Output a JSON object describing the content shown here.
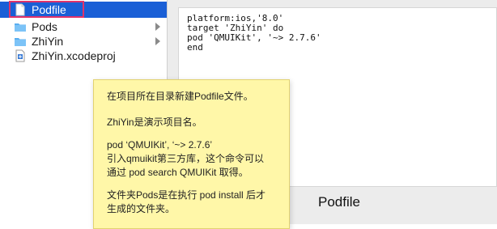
{
  "sidebar": {
    "items": [
      {
        "label": "Podfile",
        "icon": "document-icon"
      },
      {
        "label": "Pods",
        "icon": "folder-icon"
      },
      {
        "label": "ZhiYin",
        "icon": "folder-icon"
      },
      {
        "label": "ZhiYin.xcodeproj",
        "icon": "xcodeproj-icon"
      }
    ],
    "selection_color": "#1a5fd6",
    "highlight_color": "#e0336a"
  },
  "preview": {
    "code_lines": [
      "platform:ios,'8.0'",
      "target 'ZhiYin' do",
      "pod 'QMUIKit', '~> 2.7.6'",
      "end"
    ],
    "caption": "Podfile"
  },
  "note": {
    "lines": [
      "在项目所在目录新建Podfile文件。",
      "ZhiYin是演示项目名。",
      "pod ‘QMUIKit’, ‘~> 2.7.6’",
      "引入qmuikit第三方库，这个命令可以",
      "通过 pod search QMUIKit 取得。",
      "文件夹Pods是在执行 pod install 后才",
      "生成的文件夹。"
    ],
    "background": "#fff7a8"
  }
}
